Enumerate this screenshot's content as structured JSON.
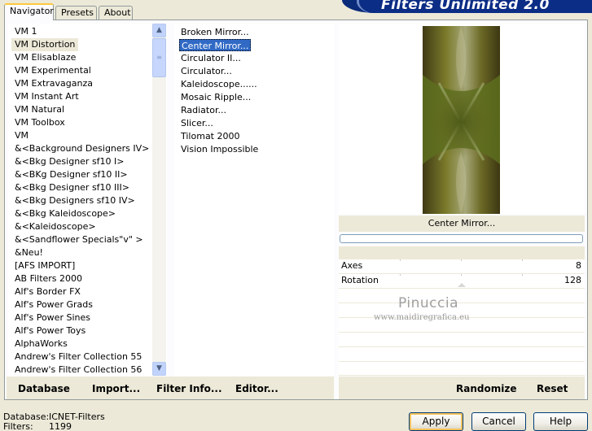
{
  "app": {
    "title": "Filters Unlimited 2.0"
  },
  "tabs": [
    {
      "label": "Navigator",
      "active": true
    },
    {
      "label": "Presets",
      "active": false
    },
    {
      "label": "About",
      "active": false
    }
  ],
  "categories": {
    "selected": "VM Distortion",
    "items": [
      "VM 1",
      "VM Distortion",
      "VM Elisablaze",
      "VM Experimental",
      "VM Extravaganza",
      "VM Instant Art",
      "VM Natural",
      "VM Toolbox",
      "VM",
      "&<Background Designers IV>",
      "&<Bkg Designer sf10 I>",
      "&<BKg Designer sf10 II>",
      "&<Bkg Designer sf10 III>",
      "&<Bkg Designers sf10 IV>",
      "&<Bkg Kaleidoscope>",
      "&<Kaleidoscope>",
      "&<Sandflower Specials\"v\" >",
      "&Neu!",
      "[AFS IMPORT]",
      "AB Filters 2000",
      "Alf's Border FX",
      "Alf's Power Grads",
      "Alf's Power Sines",
      "Alf's Power Toys",
      "AlphaWorks",
      "Andrew's Filter Collection 55",
      "Andrew's Filter Collection 56"
    ]
  },
  "filters": {
    "selected": "Center Mirror...",
    "items": [
      "Broken Mirror...",
      "Center Mirror...",
      "Circulator II...",
      "Circulator...",
      "Kaleidoscope......",
      "Mosaic Ripple...",
      "Radiator...",
      "Slicer...",
      "Tilomat 2000",
      "Vision Impossible"
    ]
  },
  "preview": {
    "filter_name": "Center Mirror..."
  },
  "parameters": [
    {
      "label": "Axes",
      "value": "8",
      "level": 0.03
    },
    {
      "label": "Rotation",
      "value": "128",
      "level": 0.5
    }
  ],
  "watermark": {
    "name": "Pinuccia",
    "url": "www.maidiregrafica.eu"
  },
  "toolbar": {
    "database": "Database",
    "import": "Import...",
    "filter_info": "Filter Info...",
    "editor": "Editor...",
    "randomize": "Randomize",
    "reset": "Reset"
  },
  "status": {
    "database_label": "Database:",
    "database_value": "ICNET-Filters",
    "filters_label": "Filters:",
    "filters_value": "1199"
  },
  "buttons": {
    "apply": "Apply",
    "cancel": "Cancel",
    "help": "Help"
  },
  "colors": {
    "selection": "#316ac5",
    "banner": "#0b2d85",
    "tab_accent": "#ffc83c"
  }
}
